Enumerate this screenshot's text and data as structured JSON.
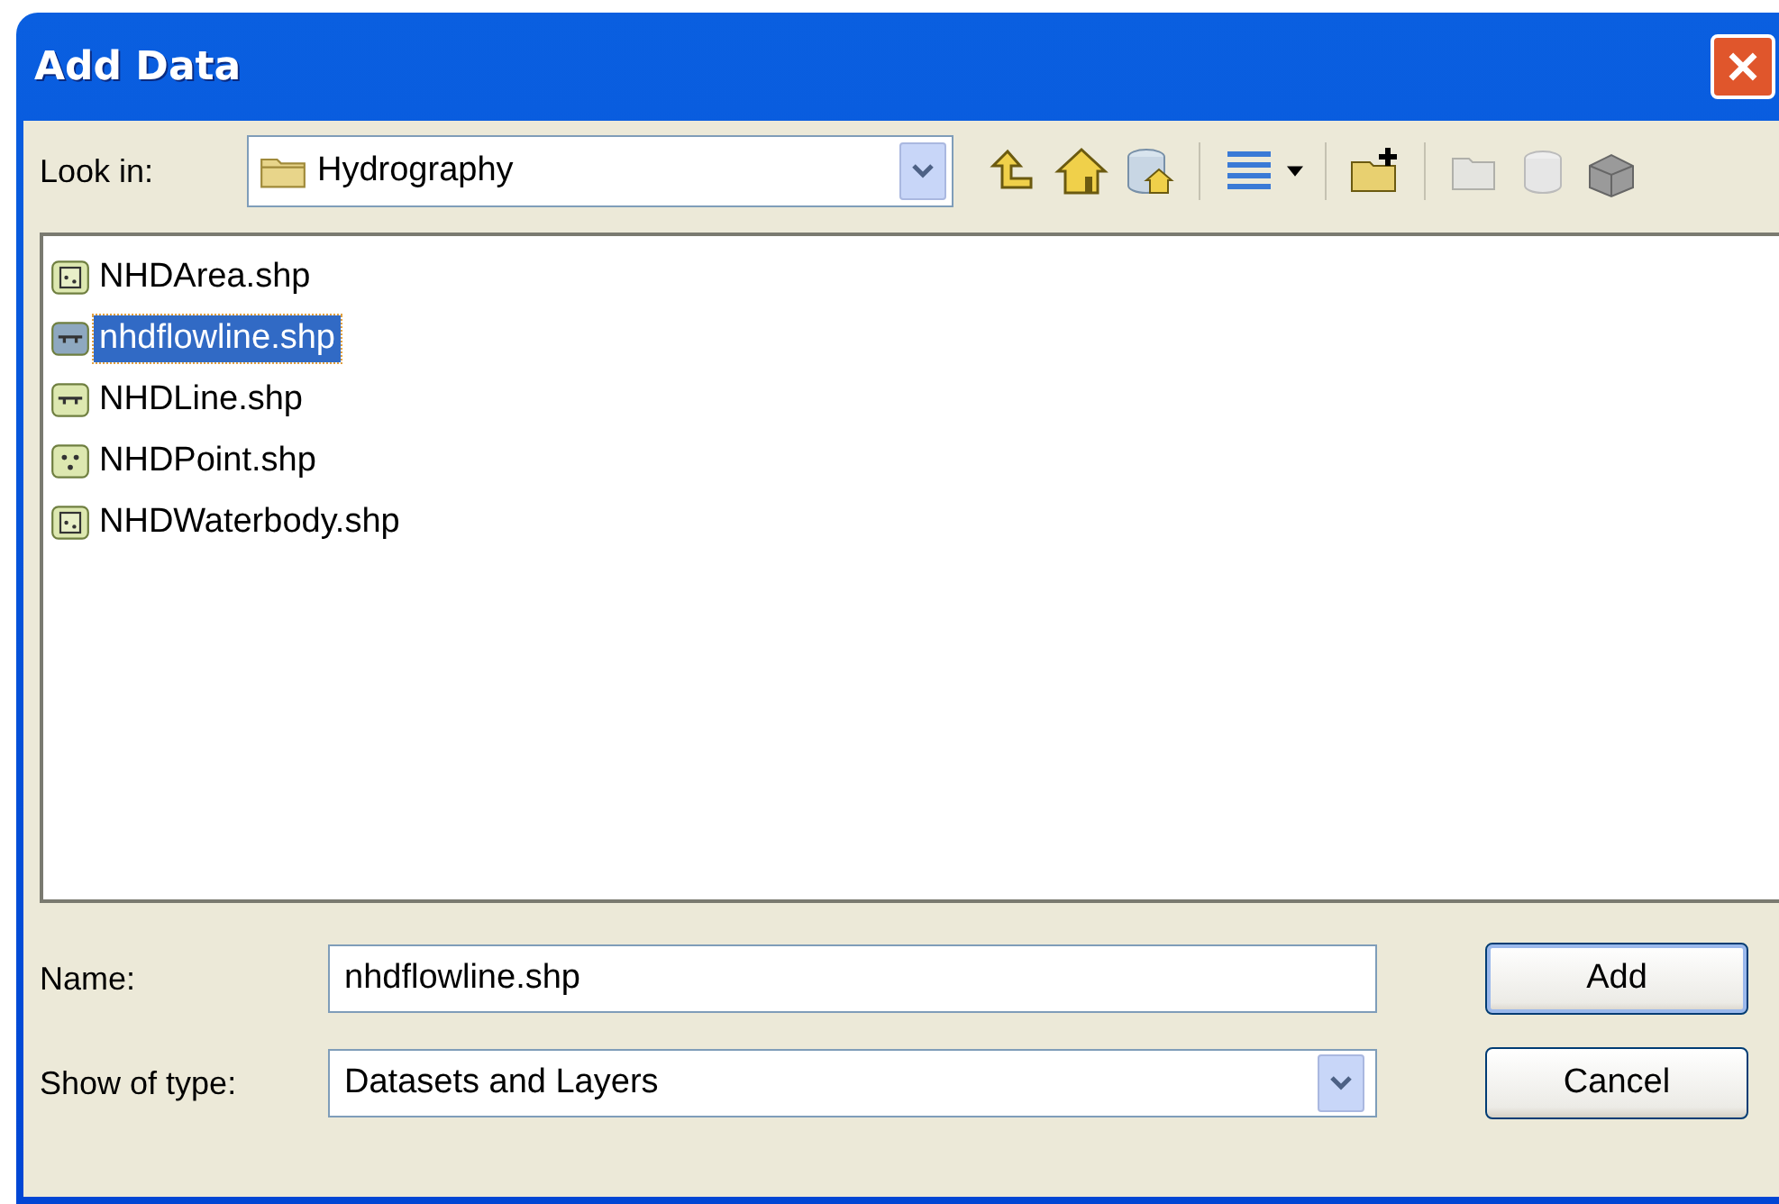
{
  "window": {
    "title": "Add Data"
  },
  "look_in": {
    "label": "Look in:",
    "value": "Hydrography"
  },
  "files": [
    {
      "name": "NHDArea.shp",
      "kind": "area",
      "selected": false
    },
    {
      "name": "nhdflowline.shp",
      "kind": "line",
      "selected": true
    },
    {
      "name": "NHDLine.shp",
      "kind": "line",
      "selected": false
    },
    {
      "name": "NHDPoint.shp",
      "kind": "point",
      "selected": false
    },
    {
      "name": "NHDWaterbody.shp",
      "kind": "area",
      "selected": false
    }
  ],
  "name_field": {
    "label": "Name:",
    "value": "nhdflowline.shp"
  },
  "type_field": {
    "label": "Show of type:",
    "value": "Datasets and Layers"
  },
  "buttons": [
    "Add",
    "Cancel"
  ]
}
